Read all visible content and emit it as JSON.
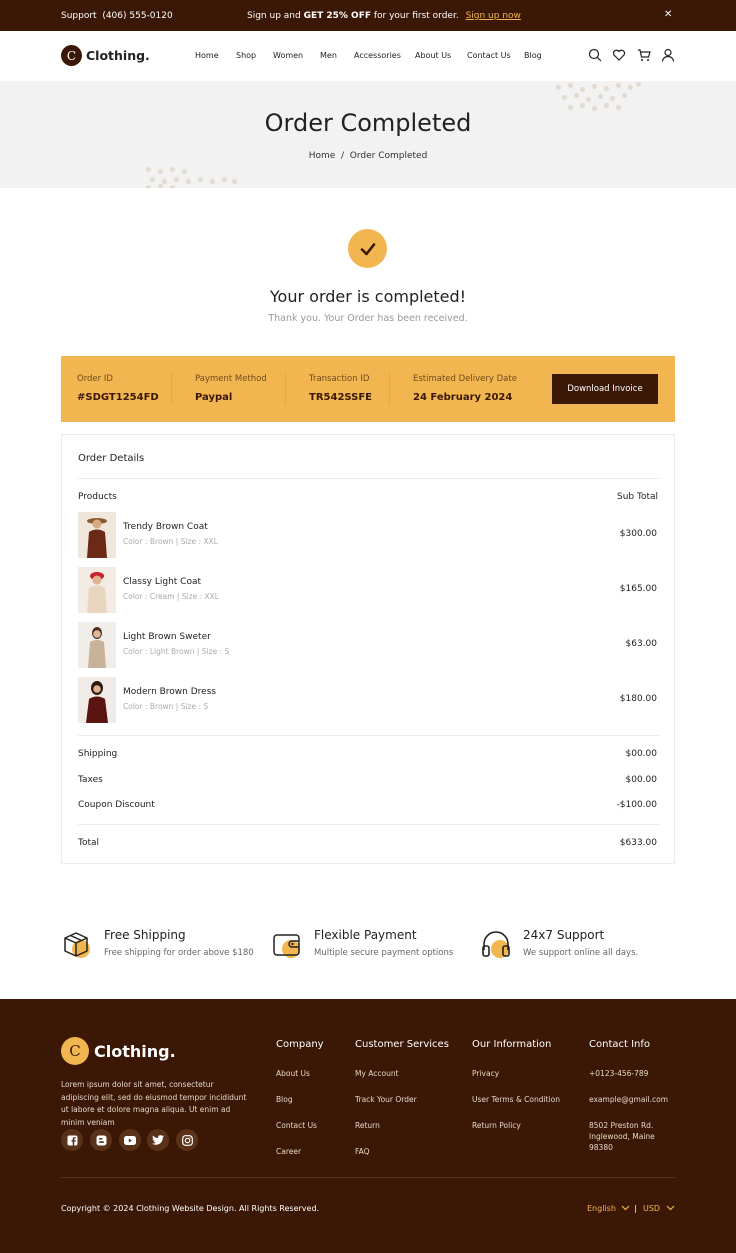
{
  "topbar": {
    "support_label": "Support",
    "phone": "(406) 555-0120",
    "promo_pre": "Sign up and ",
    "promo_bold": "GET 25% OFF",
    "promo_post": " for your first order.",
    "signup_link": "Sign up now",
    "close_icon": "close-icon"
  },
  "header": {
    "logo_letter": "C",
    "logo_text": "Clothing.",
    "nav": [
      "Home",
      "Shop",
      "Women",
      "Men",
      "Accessories",
      "About Us",
      "Contact Us",
      "Blog"
    ],
    "icons": [
      "search-icon",
      "heart-icon",
      "cart-icon",
      "user-icon"
    ]
  },
  "hero": {
    "title": "Order Completed",
    "crumb_home": "Home",
    "crumb_sep": "/",
    "crumb_current": "Order Completed"
  },
  "status": {
    "heading": "Your order is completed!",
    "subtext": "Thank you. Your Order has been received."
  },
  "summary": {
    "order_id_label": "Order ID",
    "order_id": "#SDGT1254FD",
    "payment_label": "Payment Method",
    "payment": "Paypal",
    "transaction_label": "Transaction ID",
    "transaction": "TR542SSFE",
    "delivery_label": "Estimated Delivery Date",
    "delivery": "24 February 2024",
    "download_button": "Download Invoice"
  },
  "order_details": {
    "title": "Order Details",
    "col_products": "Products",
    "col_subtotal": "Sub Total",
    "products": [
      {
        "name": "Trendy Brown Coat",
        "meta": "Color : Brown | Size : XXL",
        "price": "$300.00"
      },
      {
        "name": "Classy Light Coat",
        "meta": "Color : Cream | Size : XXL",
        "price": "$165.00"
      },
      {
        "name": "Light Brown Sweter",
        "meta": "Color : Light Brown | Size : S",
        "price": "$63.00"
      },
      {
        "name": "Modern Brown Dress",
        "meta": "Color :  Brown | Size : S",
        "price": "$180.00"
      }
    ],
    "shipping_label": "Shipping",
    "shipping": "$00.00",
    "taxes_label": "Taxes",
    "taxes": "$00.00",
    "coupon_label": "Coupon Discount",
    "coupon": "-$100.00",
    "total_label": "Total",
    "total": "$633.00"
  },
  "features": [
    {
      "title": "Free Shipping",
      "sub": "Free shipping for order above $180"
    },
    {
      "title": "Flexible Payment",
      "sub": "Multiple secure payment options"
    },
    {
      "title": "24x7 Support",
      "sub": "We support online all days."
    }
  ],
  "footer": {
    "logo_letter": "C",
    "logo_text": "Clothing.",
    "desc": "Lorem ipsum dolor sit amet, consectetur adipiscing elit, sed do eiusmod tempor incididunt ut labore et dolore magna aliqua. Ut enim ad minim veniam",
    "social": [
      "facebook-icon",
      "blogger-icon",
      "youtube-icon",
      "twitter-icon",
      "instagram-icon"
    ],
    "company": {
      "heading": "Company",
      "links": [
        "About Us",
        "Blog",
        "Contact Us",
        "Career"
      ]
    },
    "services": {
      "heading": "Customer Services",
      "links": [
        "My Account",
        "Track Your Order",
        "Return",
        "FAQ"
      ]
    },
    "info": {
      "heading": "Our Information",
      "links": [
        "Privacy",
        "User Terms & Condition",
        "Return Policy"
      ]
    },
    "contact": {
      "heading": "Contact Info",
      "phone": "+0123-456-789",
      "email": "example@gmail.com",
      "address": "8502 Preston Rd. Inglewood, Maine 98380"
    },
    "copyright": "Copyright © 2024 Clothing Website Design. All Rights Reserved.",
    "language": "English",
    "currency": "USD",
    "divider": "|"
  },
  "colors": {
    "brown": "#3b1806",
    "accent": "#f2b650",
    "hero_bg": "#f2f2f2"
  }
}
